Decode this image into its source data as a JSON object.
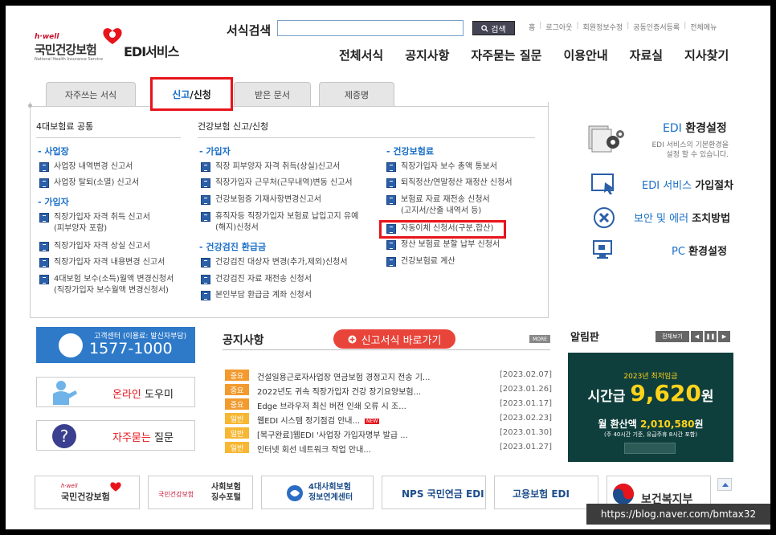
{
  "header": {
    "logo_hwell": "h·well",
    "logo_korean": "국민건강보험",
    "logo_english": "National Health Insurance Service",
    "edi_title": "EDI서비스",
    "search_label": "서식검색",
    "search_value": "",
    "search_button": "검색",
    "util_links": [
      "홈",
      "로그아웃",
      "회원정보수정",
      "공동인증서등록",
      "전체메뉴"
    ],
    "gnb": [
      "전체서식",
      "공지사항",
      "자주묻는 질문",
      "이용안내",
      "자료실",
      "지사찾기"
    ]
  },
  "tabs": {
    "items": [
      "자주쓰는 서식",
      "신고/신청",
      "받은 문서",
      "제증명"
    ],
    "active_prefix": "신고",
    "active_suffix": "/신청"
  },
  "columns": {
    "col1": {
      "title": "4대보험료 공통",
      "sections": [
        {
          "name": "- 사업장",
          "items": [
            "사업장 내역변경 신고서",
            "사업장 탈퇴(소멸) 신고서"
          ]
        },
        {
          "name": "- 가입자",
          "items": [
            "직장가입자 자격 취득 신고서\n(피부양자 포함)",
            "직장가입자 자격 상실 신고서",
            "직장가입자 자격 내용변경 신고서",
            "4대보험 보수(소득)월액 변경신청서\n(직장가입자 보수월액 변경신청서)"
          ]
        }
      ]
    },
    "col2": {
      "title": "건강보험 신고/신청",
      "sections": [
        {
          "name": "- 가입자",
          "items": [
            "직장 피부양자 자격 취득(상실)신고서",
            "직장가입자 근무처(근무내역)변동 신고서",
            "건강보험증 기재사항변경신고서",
            "휴직자등 직장가입자 보험료 납입고지 유예\n(해지)신청서"
          ]
        },
        {
          "name": "- 건강검진 환급금",
          "items": [
            "건강검진 대상자 변경(추가,제외)신청서",
            "건강검진 자료 재전송 신청서",
            "본인부담 환급금 계좌 신청서"
          ]
        }
      ]
    },
    "col3": {
      "sections": [
        {
          "name": "- 건강보험료",
          "items": [
            "직장가입자 보수 총액 통보서",
            "퇴직정산/연말정산 재정산 신청서",
            "보험료 자료 재전송 신청서\n(고지서/산출 내역서 등)",
            "자동이체 신청서(구분,합산)",
            "정산 보험료 분할 납부 신청서",
            "건강보험료 계산"
          ]
        }
      ]
    }
  },
  "right_menu": {
    "env_title_blue": "EDI",
    "env_title": "환경설정",
    "env_sub": "EDI 서비스의 기본환경을\n설정 할 수 있습니다.",
    "items": [
      {
        "blue": "EDI 서비스",
        "rest": "가입절차"
      },
      {
        "blue": "보안 및 에러",
        "rest": "조치방법"
      },
      {
        "blue": "PC",
        "rest": "환경설정"
      }
    ]
  },
  "lower": {
    "call_label": "고객센터 (이용료: 발신자부담)",
    "call_number": "1577-1000",
    "online_help_red": "온라인",
    "online_help": "도우미",
    "faq_red": "자주묻는",
    "faq": "질문",
    "notice_title": "공지사항",
    "report_button": "신고서식 바로가기",
    "more": "MORE",
    "notices": [
      {
        "badge": "중요",
        "title": "건설일용근로자사업장 연금보험 경정고지 전송 기...",
        "date": "[2023.02.07]"
      },
      {
        "badge": "중요",
        "title": "2022년도 귀속 직장가입자 건강 장기요양보험...",
        "date": "[2023.01.26]"
      },
      {
        "badge": "중요",
        "title": "Edge 브라우저 최신 버전 인쇄 오류 시 조...",
        "date": "[2023.01.17]"
      },
      {
        "badge": "일반",
        "title": "웹EDI 시스템 정기점검 안내...",
        "date": "[2023.02.23]",
        "new": "NEW"
      },
      {
        "badge": "일반",
        "title": "[복구완료]웹EDI '사업장 가입자명부 발급 ...",
        "date": "[2023.01.30]"
      },
      {
        "badge": "일반",
        "title": "인터넷 회선 네트워크 작업 안내...",
        "date": "[2023.01.27]"
      }
    ],
    "alarm_title": "알림판",
    "alarm_all": "전체보기",
    "wage_year": "2023년 최저임금",
    "wage_prefix": "시간급",
    "wage_value": "9,620",
    "wage_unit": "원",
    "month_prefix": "월 환산액",
    "month_value": "2,010,580",
    "month_unit": "원",
    "month_note": "(주 40시간 기준, 유급주휴 8시간 포함)",
    "banners": [
      "국민건강보험",
      "사회보험\n징수포털",
      "4대사회보험\n정보연계센터",
      "NPS 국민연금 EDI",
      "고용보험 EDI",
      "보건복지부"
    ],
    "banner_hwell": "h·well",
    "url": "https://blog.naver.com/bmtax32"
  },
  "colors": {
    "accent": "#1a6fc7",
    "highlight": "#e8141b",
    "tab_bg": "#e6e6e6"
  }
}
